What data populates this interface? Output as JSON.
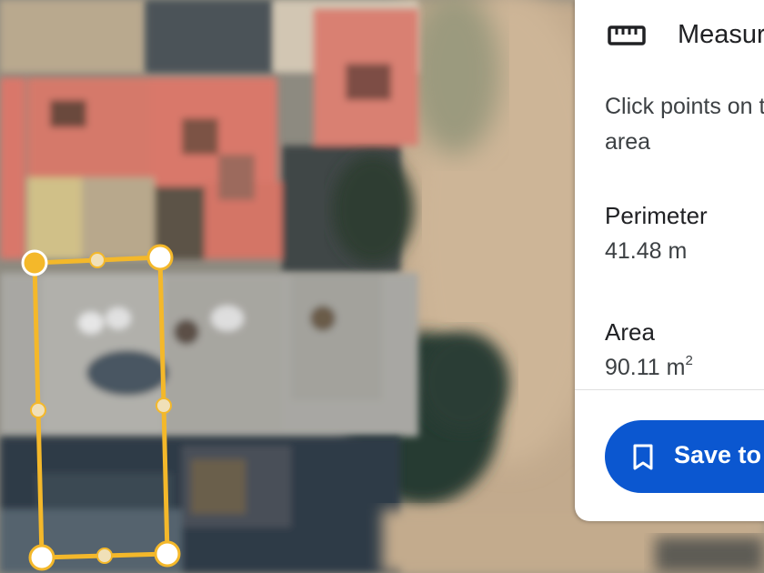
{
  "panel": {
    "title": "Measure distance",
    "instruction_line1": "Click points on the map to measure",
    "instruction_line2": "area",
    "perimeter_label": "Perimeter",
    "perimeter_value": "41.48 m",
    "area_label": "Area",
    "area_value": "90.11 m",
    "area_unit_superscript": "2",
    "save_label": "Save to"
  },
  "colors": {
    "measure_line": "#f4b82a",
    "vertex_fill": "#ffffff",
    "active_vertex": "#f4b82a",
    "button_blue": "#0b57d0",
    "roof_tile": "#d9776a"
  },
  "icons": {
    "panel_icon": "ruler-icon",
    "save_icon": "bookmark-icon"
  }
}
